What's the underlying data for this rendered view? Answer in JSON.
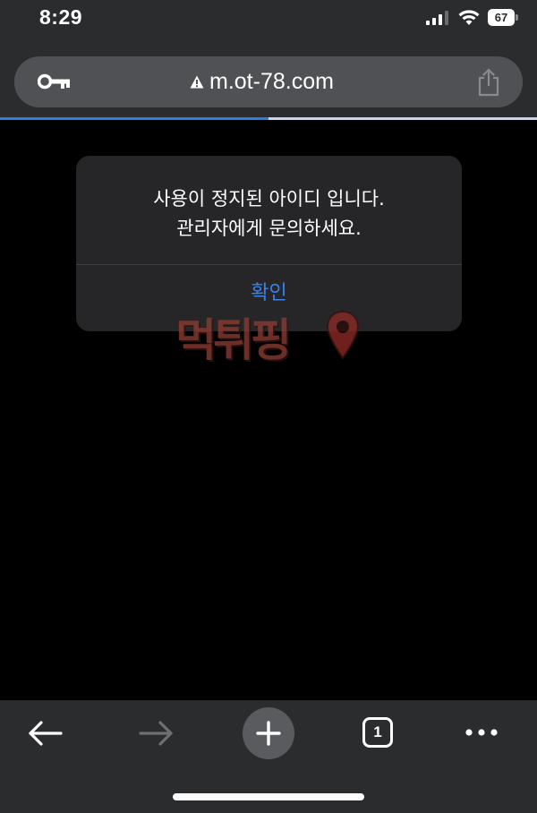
{
  "status_bar": {
    "time": "8:29",
    "battery_level": "67",
    "icons": [
      "signal-icon",
      "wifi-icon",
      "battery-icon"
    ]
  },
  "browser": {
    "url": "m.ot-78.com",
    "security": "not-secure-warning",
    "load_progress_percent": 50,
    "tab_count": "1",
    "toolbar_icons": [
      "back-icon",
      "forward-icon",
      "plus-icon",
      "tabs-icon",
      "more-icon"
    ]
  },
  "alert": {
    "message_line1": "사용이 정지된 아이디 입니다.",
    "message_line2": "관리자에게 문의하세요.",
    "confirm_label": "확인"
  },
  "watermark": {
    "text": "먹튀핑"
  },
  "colors": {
    "chrome_bar": "#2b2c2e",
    "address_bar": "#505154",
    "alert_bg": "#262628",
    "accent_blue": "#3a82e8",
    "watermark": "#8c3b33"
  }
}
